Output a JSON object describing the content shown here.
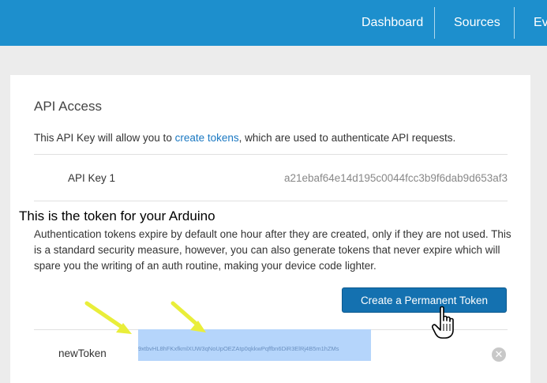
{
  "nav": {
    "dashboard": "Dashboard",
    "sources": "Sources",
    "events": "Eve"
  },
  "panel": {
    "title": "API Access",
    "intro_before": "This API Key will allow you to ",
    "intro_link": "create tokens",
    "intro_after": ", which are used to authenticate API requests.",
    "api_key_label": "API Key 1",
    "api_key_value": "a21ebaf64e14d195c0044fcc3b9f6dab9d653af3",
    "auth_text": "Authentication tokens expire by default one hour after they are created, only if they are not used. This is a standard security measure, however, you can also generate tokens that never expire which will spare you the writing of an auth routine, making your device code lighter.",
    "create_button": "Create a Permanent Token",
    "token_label": "newToken",
    "token_value": "9xtbvHL8hFKxfkmlXUW3qNoUpOEZAtp0qkkwPqffbn6DiR3ElRj4B5m1hZMs",
    "clear_icon": "✕"
  },
  "annotation": {
    "text": "This is the token for your Arduino",
    "arrow_color": "#e9ee3a"
  },
  "colors": {
    "topbar": "#1d8fcd",
    "button": "#1471b0",
    "link": "#1a78c2",
    "token_highlight": "#b5d5fb"
  }
}
